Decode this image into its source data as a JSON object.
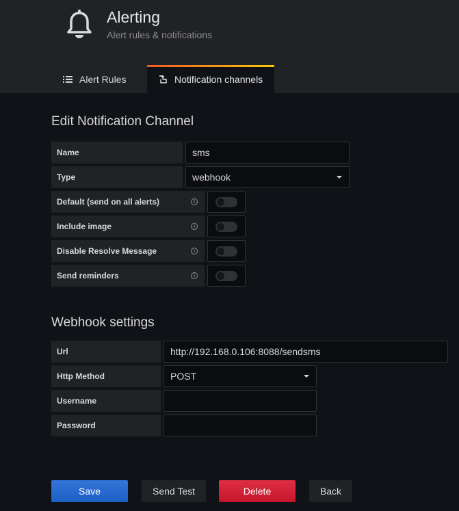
{
  "header": {
    "title": "Alerting",
    "subtitle": "Alert rules & notifications",
    "icon": "bell-icon"
  },
  "tabs": [
    {
      "label": "Alert Rules",
      "icon": "list-icon",
      "active": false
    },
    {
      "label": "Notification channels",
      "icon": "channel-icon",
      "active": true
    }
  ],
  "edit_section": {
    "title": "Edit Notification Channel",
    "name": {
      "label": "Name",
      "value": "sms"
    },
    "type": {
      "label": "Type",
      "value": "webhook"
    },
    "toggles": [
      {
        "label": "Default (send on all alerts)",
        "checked": false
      },
      {
        "label": "Include image",
        "checked": false
      },
      {
        "label": "Disable Resolve Message",
        "checked": false
      },
      {
        "label": "Send reminders",
        "checked": false
      }
    ]
  },
  "webhook": {
    "title": "Webhook settings",
    "url": {
      "label": "Url",
      "value": "http://192.168.0.106:8088/sendsms"
    },
    "method": {
      "label": "Http Method",
      "value": "POST"
    },
    "username": {
      "label": "Username",
      "value": ""
    },
    "password": {
      "label": "Password",
      "value": ""
    }
  },
  "buttons": {
    "save": "Save",
    "send_test": "Send Test",
    "delete": "Delete",
    "back": "Back"
  },
  "colors": {
    "primary": "#3274d9",
    "danger": "#e02f44",
    "tab_accent_start": "#f05a28",
    "tab_accent_end": "#fbca0a"
  }
}
